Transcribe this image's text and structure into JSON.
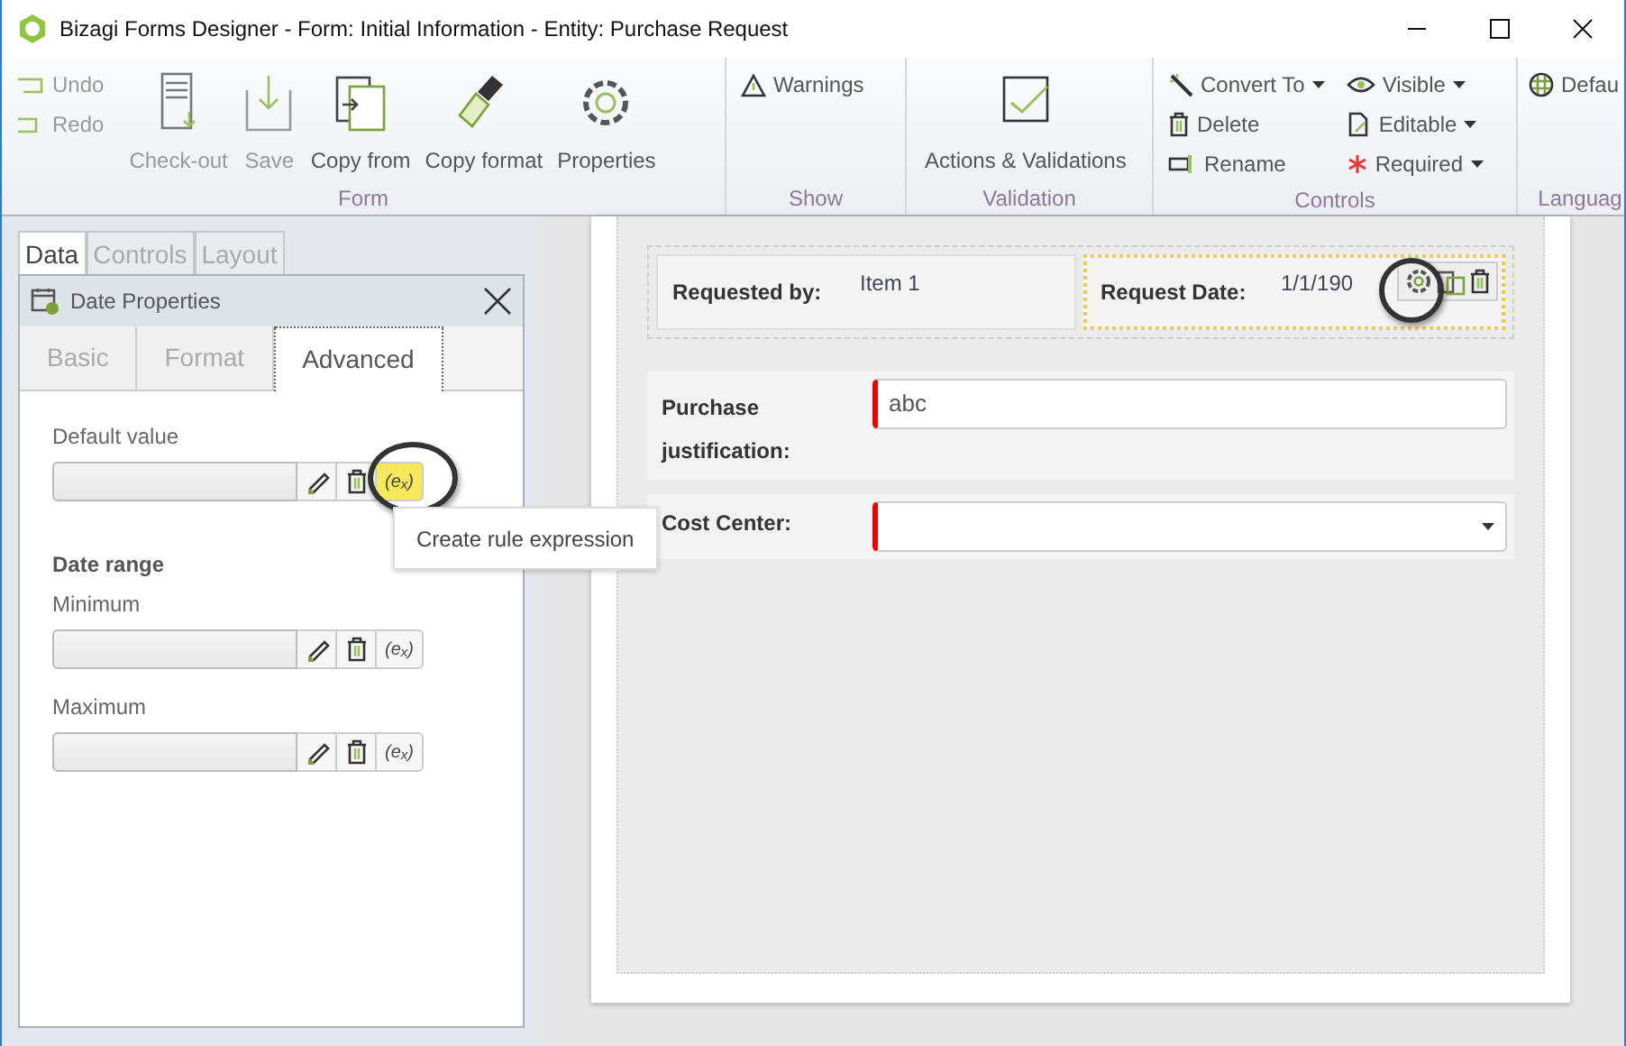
{
  "window": {
    "title": "Bizagi Forms Designer  - Form: Initial Information - Entity:  Purchase Request"
  },
  "ribbon": {
    "groups": [
      {
        "label": "Form",
        "items": [
          {
            "kind": "small",
            "label": "Undo",
            "disabled": true
          },
          {
            "kind": "small",
            "label": "Redo",
            "disabled": true
          },
          {
            "kind": "large",
            "label": "Check-out",
            "disabled": true
          },
          {
            "kind": "large",
            "label": "Save",
            "disabled": true
          },
          {
            "kind": "large",
            "label": "Copy from",
            "disabled": false
          },
          {
            "kind": "large",
            "label": "Copy format",
            "disabled": false
          },
          {
            "kind": "large",
            "label": "Properties",
            "disabled": false
          }
        ]
      },
      {
        "label": "Show",
        "items": [
          {
            "kind": "small",
            "label": "Warnings",
            "disabled": false
          }
        ]
      },
      {
        "label": "Validation",
        "items": [
          {
            "kind": "large",
            "label": "Actions & Validations",
            "disabled": false
          }
        ]
      },
      {
        "label": "Controls",
        "items": [
          {
            "kind": "small",
            "label": "Convert To",
            "dropdown": true,
            "disabled": false
          },
          {
            "kind": "small",
            "label": "Delete",
            "dropdown": false,
            "disabled": false
          },
          {
            "kind": "small",
            "label": "Rename",
            "dropdown": false,
            "disabled": false
          },
          {
            "kind": "small",
            "label": "Visible",
            "dropdown": true,
            "disabled": false
          },
          {
            "kind": "small",
            "label": "Editable",
            "dropdown": true,
            "disabled": false
          },
          {
            "kind": "small",
            "label": "Required",
            "dropdown": true,
            "disabled": false
          }
        ]
      },
      {
        "label": "Languag",
        "items": [
          {
            "kind": "small",
            "label": "Defau",
            "disabled": false
          }
        ]
      }
    ]
  },
  "side_tabs": [
    {
      "label": "Data",
      "selected": true
    },
    {
      "label": "Controls",
      "selected": false
    },
    {
      "label": "Layout",
      "selected": false
    }
  ],
  "properties_panel": {
    "title": "Date Properties",
    "tabs": [
      {
        "label": "Basic",
        "selected": false
      },
      {
        "label": "Format",
        "selected": false
      },
      {
        "label": "Advanced",
        "selected": true
      }
    ],
    "fields": [
      {
        "kind": "field",
        "label": "Default value",
        "rule_button": "(e$_{x}$)",
        "highlighted": true,
        "tooltip": "Create rule expression"
      },
      {
        "kind": "heading",
        "label": "Date range"
      },
      {
        "kind": "field",
        "label": "Minimum",
        "rule_button": "(e$_{x}$)",
        "highlighted": false
      },
      {
        "kind": "field",
        "label": "Maximum",
        "rule_button": "(e$_{x}$)",
        "highlighted": false
      }
    ]
  },
  "form": {
    "rows": [
      {
        "kind": "group",
        "cells": [
          {
            "label": "Requested by:",
            "value": "Item 1",
            "selected": false
          },
          {
            "label": "Request Date:",
            "value": "1/1/190",
            "selected": true,
            "gear_highlighted": true
          }
        ]
      },
      {
        "kind": "text",
        "label": "Purchase justification:",
        "value": "abc",
        "required": true
      },
      {
        "kind": "dropdown",
        "label": "Cost Center:",
        "value": "",
        "required": true
      }
    ]
  }
}
